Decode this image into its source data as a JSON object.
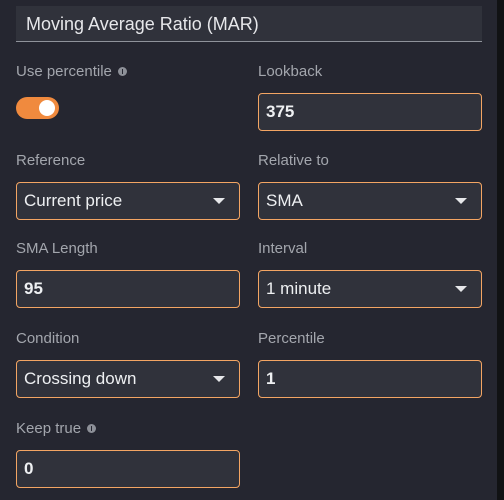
{
  "panel": {
    "title": "Moving Average Ratio (MAR)"
  },
  "fields": {
    "use_percentile": {
      "label": "Use percentile",
      "enabled": true
    },
    "lookback": {
      "label": "Lookback",
      "value": "375"
    },
    "reference": {
      "label": "Reference",
      "value": "Current price"
    },
    "relative_to": {
      "label": "Relative to",
      "value": "SMA"
    },
    "sma_length": {
      "label": "SMA Length",
      "value": "95"
    },
    "interval": {
      "label": "Interval",
      "value": "1 minute"
    },
    "condition": {
      "label": "Condition",
      "value": "Crossing down"
    },
    "percentile": {
      "label": "Percentile",
      "value": "1"
    },
    "keep_true": {
      "label": "Keep true",
      "value": "0"
    }
  },
  "colors": {
    "accent": "#f08a3e",
    "field_border": "#f3a563",
    "panel_bg": "#252630",
    "field_bg": "#30323b"
  },
  "icons": {
    "info": "info-icon",
    "dropdown": "chevron-down-icon"
  }
}
